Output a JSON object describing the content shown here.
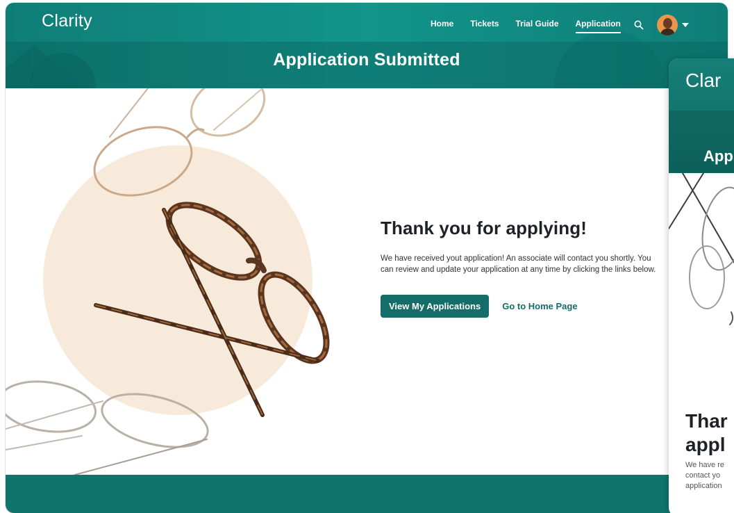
{
  "header": {
    "brand": "Clarity",
    "nav": [
      {
        "label": "Home",
        "active": false
      },
      {
        "label": "Tickets",
        "active": false
      },
      {
        "label": "Trial Guide",
        "active": false
      },
      {
        "label": "Application",
        "active": true
      }
    ],
    "search_icon": "search-icon",
    "avatar_icon": "avatar",
    "menu_icon": "chevron-down-icon"
  },
  "page": {
    "title": "Application Submitted"
  },
  "message": {
    "heading": "Thank you for applying!",
    "body": "We have received yout application! An associate will contact you shortly. You can review and update your application at any time by clicking the links below."
  },
  "actions": {
    "primary_label": "View My Applications",
    "secondary_label": "Go to Home Page"
  },
  "mobile": {
    "brand": "Clar",
    "title": "App",
    "heading_line1": "Thar",
    "heading_line2": "appl",
    "body_line1": "We have re",
    "body_line2": "contact yo",
    "body_line3": "application"
  },
  "colors": {
    "primary": "#146d68",
    "header_teal": "#12948a",
    "peach": "#f8eadb",
    "text_dark": "#1e2226"
  }
}
